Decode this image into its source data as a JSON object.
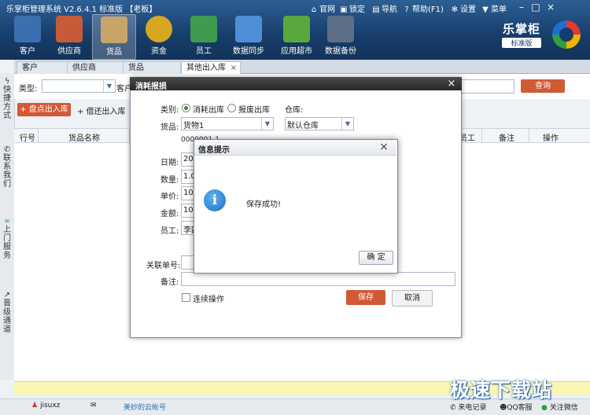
{
  "app": {
    "title": "乐掌柜管理系统 V2.6.4.1 标准版 【老板】",
    "top_buttons": [
      {
        "label": "官网",
        "icon": "home-icon"
      },
      {
        "label": "锁定",
        "icon": "lock-icon"
      },
      {
        "label": "导航",
        "icon": "navigation-icon"
      },
      {
        "label": "帮助(F1)",
        "icon": "help-icon"
      },
      {
        "label": "设置",
        "icon": "gear-icon"
      },
      {
        "label": "菜单",
        "icon": "shirt-icon"
      }
    ]
  },
  "nav": [
    {
      "label": "客户",
      "icon": "customer-icon",
      "color": "#3a6fb0"
    },
    {
      "label": "供应商",
      "icon": "truck-icon",
      "color": "#c75b39"
    },
    {
      "label": "货品",
      "icon": "boxes-icon",
      "color": "#c9a46a",
      "active": true
    },
    {
      "label": "资金",
      "icon": "money-bag-icon",
      "color": "#d8a722"
    },
    {
      "label": "员工",
      "icon": "employee-icon",
      "color": "#3f9b4d"
    },
    {
      "label": "数据同步",
      "icon": "sync-icon",
      "color": "#4c8fd6"
    },
    {
      "label": "应用超市",
      "icon": "cart-icon",
      "color": "#5aa83c"
    },
    {
      "label": "数据备份",
      "icon": "backup-icon",
      "color": "#5c6f86"
    }
  ],
  "brand": {
    "name": "乐掌柜",
    "edition": "标准版"
  },
  "tabs": [
    "客户",
    "供应商",
    "货品",
    "其他出入库"
  ],
  "tab_close": "×",
  "sidebar": [
    "快捷方式",
    "联系我们",
    "上门服务",
    "晋级通道"
  ],
  "search": {
    "type_label": "类型:",
    "customer_label": "客户",
    "query_button": "查询"
  },
  "toolbar": {
    "inout_button": "+ 盘点出入库",
    "transfer_button": "+ 借还出入库"
  },
  "grid": {
    "columns": [
      "行号",
      "货品名称",
      "员工",
      "备注",
      "操作"
    ]
  },
  "dialog": {
    "title": "消耗报损",
    "close": "×",
    "category_label": "类别:",
    "option1": "消耗出库",
    "option2": "报废出库",
    "warehouse_label": "仓库:",
    "goods_label": "货品:",
    "goods_value": "货物1",
    "warehouse_value": "默认仓库",
    "code_value": "0000001-1",
    "date_label": "日期:",
    "date_value": "20",
    "qty_label": "数量:",
    "qty_value": "1.0",
    "price_label": "单价:",
    "price_value": "100",
    "amount_label": "金额:",
    "amount_value": "100",
    "staff_label": "员工:",
    "staff_value": "李四",
    "related_label": "关联单号:",
    "remark_label": "备注:",
    "continuous_label": "连续操作",
    "save_button": "保存",
    "cancel_button": "取消"
  },
  "message_box": {
    "title": "信息提示",
    "close": "×",
    "message": "保存成功!",
    "ok_button": "确 定",
    "icon_glyph": "i"
  },
  "footer": {
    "user": "jisuxz",
    "cloud_account": "美妙的云帐号",
    "call_record": "来电记录",
    "qq_service": "QQ客服",
    "wechat": "关注微信"
  },
  "watermark": "极速下载站"
}
